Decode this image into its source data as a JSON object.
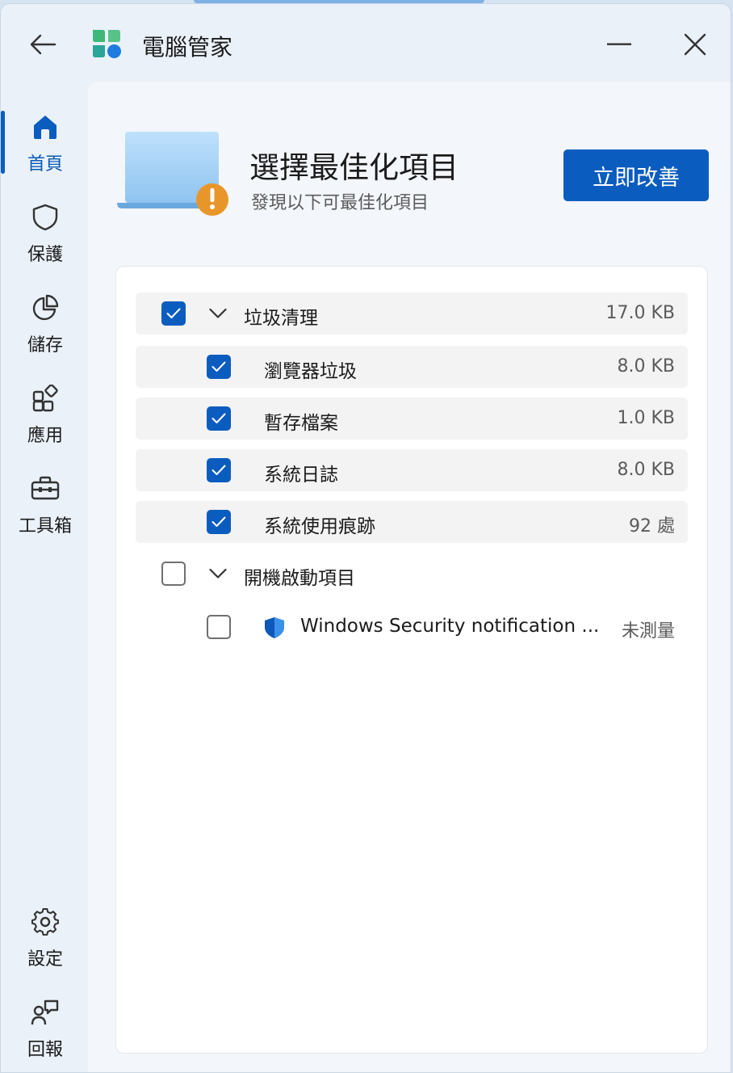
{
  "app": {
    "title": "電腦管家"
  },
  "sidebar": {
    "items": [
      {
        "label": "首頁",
        "icon": "home-icon",
        "active": true
      },
      {
        "label": "保護",
        "icon": "shield-icon"
      },
      {
        "label": "儲存",
        "icon": "pie-chart-icon"
      },
      {
        "label": "應用",
        "icon": "apps-icon"
      },
      {
        "label": "工具箱",
        "icon": "toolbox-icon"
      }
    ],
    "bottom_items": [
      {
        "label": "設定",
        "icon": "gear-icon"
      },
      {
        "label": "回報",
        "icon": "feedback-icon"
      }
    ]
  },
  "hero": {
    "title": "選擇最佳化項目",
    "subtitle": "發現以下可最佳化項目",
    "button_label": "立即改善",
    "illustration": "laptop-warning-icon"
  },
  "list": {
    "groups": [
      {
        "label": "垃圾清理",
        "size": "17.0 KB",
        "checked": true,
        "expanded": true,
        "items": [
          {
            "label": "瀏覽器垃圾",
            "size": "8.0 KB",
            "checked": true
          },
          {
            "label": "暫存檔案",
            "size": "1.0 KB",
            "checked": true
          },
          {
            "label": "系統日誌",
            "size": "8.0 KB",
            "checked": true
          },
          {
            "label": "系統使用痕跡",
            "size": "92 處",
            "checked": true
          }
        ]
      },
      {
        "label": "開機啟動項目",
        "checked": false,
        "expanded": true,
        "items": [
          {
            "label": "Windows Security notification ...",
            "size": "未測量",
            "checked": false,
            "icon": "windows-security-icon"
          }
        ]
      }
    ]
  },
  "colors": {
    "accent": "#0b5cbf",
    "warning": "#e8962a"
  }
}
